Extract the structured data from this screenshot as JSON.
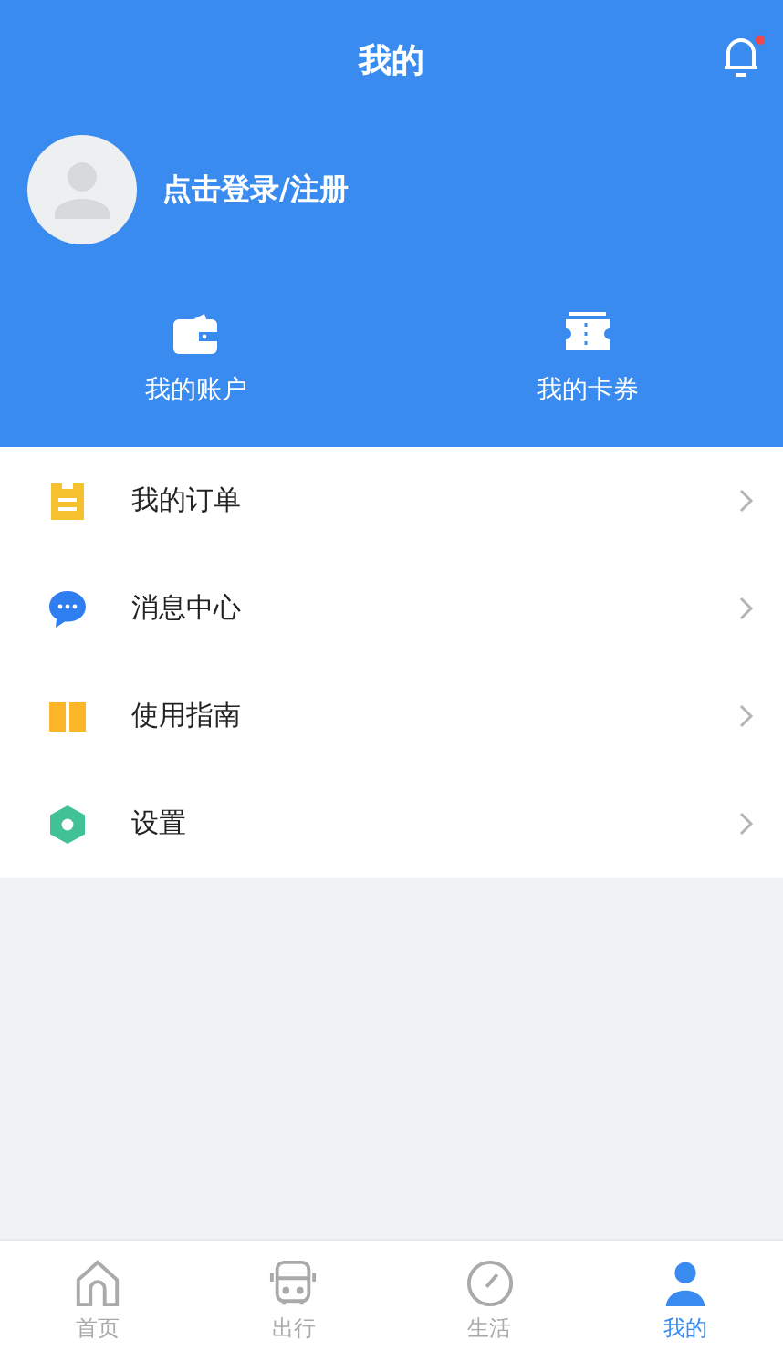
{
  "header": {
    "title": "我的",
    "notification": {
      "unread": true
    }
  },
  "profile": {
    "login_text": "点击登录/注册"
  },
  "shortcuts": [
    {
      "kind": "wallet",
      "label": "我的账户"
    },
    {
      "kind": "ticket",
      "label": "我的卡券"
    }
  ],
  "menu": [
    {
      "kind": "orders",
      "label": "我的订单"
    },
    {
      "kind": "messages",
      "label": "消息中心"
    },
    {
      "kind": "guide",
      "label": "使用指南"
    },
    {
      "kind": "settings",
      "label": "设置"
    }
  ],
  "tabs": [
    {
      "kind": "home",
      "label": "首页",
      "selected": false
    },
    {
      "kind": "bus",
      "label": "出行",
      "selected": false
    },
    {
      "kind": "compass",
      "label": "生活",
      "selected": false
    },
    {
      "kind": "person",
      "label": "我的",
      "selected": true
    }
  ]
}
